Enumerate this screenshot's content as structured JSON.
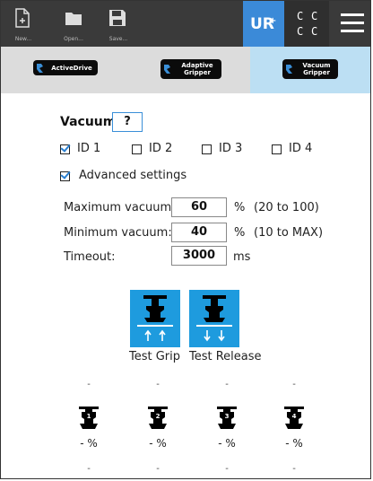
{
  "toolbar": {
    "new_label": "New...",
    "open_label": "Open...",
    "save_label": "Save...",
    "cc_text": [
      "C",
      "C",
      "C",
      "C"
    ]
  },
  "tabs": [
    {
      "label": "ActiveDrive",
      "active": false
    },
    {
      "label_line1": "Adaptive",
      "label_line2": "Gripper",
      "active": false
    },
    {
      "label_line1": "Vacuum",
      "label_line2": "Gripper",
      "active": true
    }
  ],
  "vacuum": {
    "title": "Vacuum",
    "status": "?",
    "ids": [
      {
        "label": "ID 1",
        "checked": true
      },
      {
        "label": "ID 2",
        "checked": false
      },
      {
        "label": "ID 3",
        "checked": false
      },
      {
        "label": "ID 4",
        "checked": false
      }
    ],
    "advanced_label": "Advanced settings",
    "advanced_checked": true
  },
  "settings": {
    "max_label": "Maximum vacuum:",
    "max_value": "60",
    "max_unit": "%",
    "max_range": "(20 to 100)",
    "min_label": "Minimum vacuum:",
    "min_value": "40",
    "min_unit": "%",
    "min_range": "(10 to MAX)",
    "timeout_label": "Timeout:",
    "timeout_value": "3000",
    "timeout_unit": "ms"
  },
  "actions": {
    "grip_label": "Test Grip",
    "release_label": "Test Release"
  },
  "cups": [
    {
      "id": "1",
      "top": "-",
      "pct": "- %",
      "bottom": "-"
    },
    {
      "id": "2",
      "top": "-",
      "pct": "- %",
      "bottom": "-"
    },
    {
      "id": "3",
      "top": "-",
      "pct": "- %",
      "bottom": "-"
    },
    {
      "id": "4",
      "top": "-",
      "pct": "- %",
      "bottom": "-"
    }
  ],
  "colors": {
    "accent": "#1e9bde",
    "active_tab": "#bcdff3",
    "topbar": "#3a3a3a",
    "ur_tile": "#3b8ad8"
  }
}
